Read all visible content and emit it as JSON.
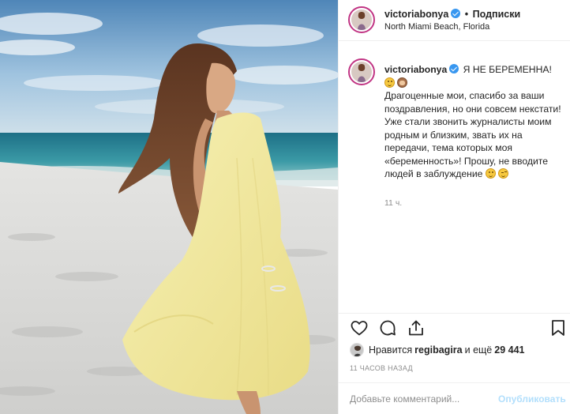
{
  "header": {
    "username": "victoriabonya",
    "separator": "•",
    "follow_label": "Подписки",
    "location": "North Miami Beach, Florida"
  },
  "caption": {
    "username": "victoriabonya",
    "title": "Я НЕ БЕРЕМЕННА!",
    "body": "Драгоценные мои, спасибо за ваши поздравления, но они совсем некстати! Уже стали звонить журналисты моим родным и близким, звать их на передачи, тема которых моя «беременность»! Прошу, не вводите людей в заблуждение",
    "time": "11 ч."
  },
  "likes": {
    "prefix": "Нравится",
    "user": "regibagira",
    "middle": "и ещё",
    "count": "29 441"
  },
  "post_time": "11 ЧАСОВ НАЗАД",
  "comment": {
    "placeholder": "Добавьте комментарий...",
    "publish_label": "Опубликовать"
  },
  "icons": {
    "like": "heart-icon",
    "comment": "comment-icon",
    "share": "share-icon",
    "save": "bookmark-icon",
    "verified": "verified-badge-icon"
  },
  "colors": {
    "verified": "#3897f0",
    "publish_disabled": "#b2dffc",
    "avatar_ring": "#c13584",
    "dress": "#f3eaa0"
  }
}
